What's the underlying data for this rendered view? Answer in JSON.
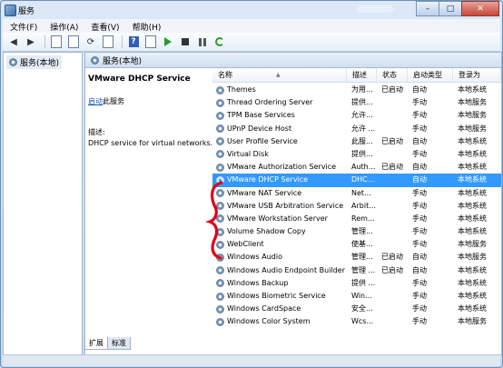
{
  "window": {
    "title": "服务",
    "min": "–",
    "max": "□",
    "close": "✕"
  },
  "menu": [
    "文件(F)",
    "操作(A)",
    "查看(V)",
    "帮助(H)"
  ],
  "tree": {
    "root_label": "服务(本地)"
  },
  "header": {
    "label": "服务(本地)"
  },
  "details": {
    "service_title": "VMware DHCP Service",
    "start_link": "启动",
    "start_suffix": "此服务",
    "desc_label": "描述:",
    "desc_text": "DHCP service for virtual networks."
  },
  "columns": {
    "name": "名称",
    "desc": "描述",
    "status": "状态",
    "startup": "启动类型",
    "logon": "登录为"
  },
  "rows": [
    {
      "name": "Themes",
      "desc": "为用...",
      "status": "已启动",
      "startup": "自动",
      "logon": "本地系统"
    },
    {
      "name": "Thread Ordering Server",
      "desc": "提供...",
      "status": "",
      "startup": "手动",
      "logon": "本地服务"
    },
    {
      "name": "TPM Base Services",
      "desc": "允许...",
      "status": "",
      "startup": "手动",
      "logon": "本地服务"
    },
    {
      "name": "UPnP Device Host",
      "desc": "允许 ...",
      "status": "",
      "startup": "手动",
      "logon": "本地服务"
    },
    {
      "name": "User Profile Service",
      "desc": "此服...",
      "status": "已启动",
      "startup": "自动",
      "logon": "本地系统"
    },
    {
      "name": "Virtual Disk",
      "desc": "提供...",
      "status": "",
      "startup": "手动",
      "logon": "本地系统"
    },
    {
      "name": "VMware Authorization Service",
      "desc": "Auth...",
      "status": "已启动",
      "startup": "自动",
      "logon": "本地系统"
    },
    {
      "name": "VMware DHCP Service",
      "desc": "DHC...",
      "status": "",
      "startup": "自动",
      "logon": "本地系统",
      "selected": true
    },
    {
      "name": "VMware NAT Service",
      "desc": "Net...",
      "status": "",
      "startup": "手动",
      "logon": "本地系统"
    },
    {
      "name": "VMware USB Arbitration Service",
      "desc": "Arbit...",
      "status": "",
      "startup": "手动",
      "logon": "本地系统"
    },
    {
      "name": "VMware Workstation Server",
      "desc": "Rem...",
      "status": "",
      "startup": "手动",
      "logon": "本地系统"
    },
    {
      "name": "Volume Shadow Copy",
      "desc": "管理...",
      "status": "",
      "startup": "手动",
      "logon": "本地系统"
    },
    {
      "name": "WebClient",
      "desc": "使基...",
      "status": "",
      "startup": "手动",
      "logon": "本地服务"
    },
    {
      "name": "Windows Audio",
      "desc": "管理...",
      "status": "已启动",
      "startup": "自动",
      "logon": "本地服务"
    },
    {
      "name": "Windows Audio Endpoint Builder",
      "desc": "管理 ...",
      "status": "已启动",
      "startup": "自动",
      "logon": "本地系统"
    },
    {
      "name": "Windows Backup",
      "desc": "提供 ...",
      "status": "",
      "startup": "手动",
      "logon": "本地系统"
    },
    {
      "name": "Windows Biometric Service",
      "desc": "Win...",
      "status": "",
      "startup": "手动",
      "logon": "本地系统"
    },
    {
      "name": "Windows CardSpace",
      "desc": "安全...",
      "status": "",
      "startup": "手动",
      "logon": "本地系统"
    },
    {
      "name": "Windows Color System",
      "desc": "Wcs...",
      "status": "",
      "startup": "手动",
      "logon": "本地服务"
    }
  ],
  "tabs": [
    "扩展",
    "标准"
  ],
  "colors": {
    "selection": "#3399ff",
    "annotation": "#e0001a"
  }
}
